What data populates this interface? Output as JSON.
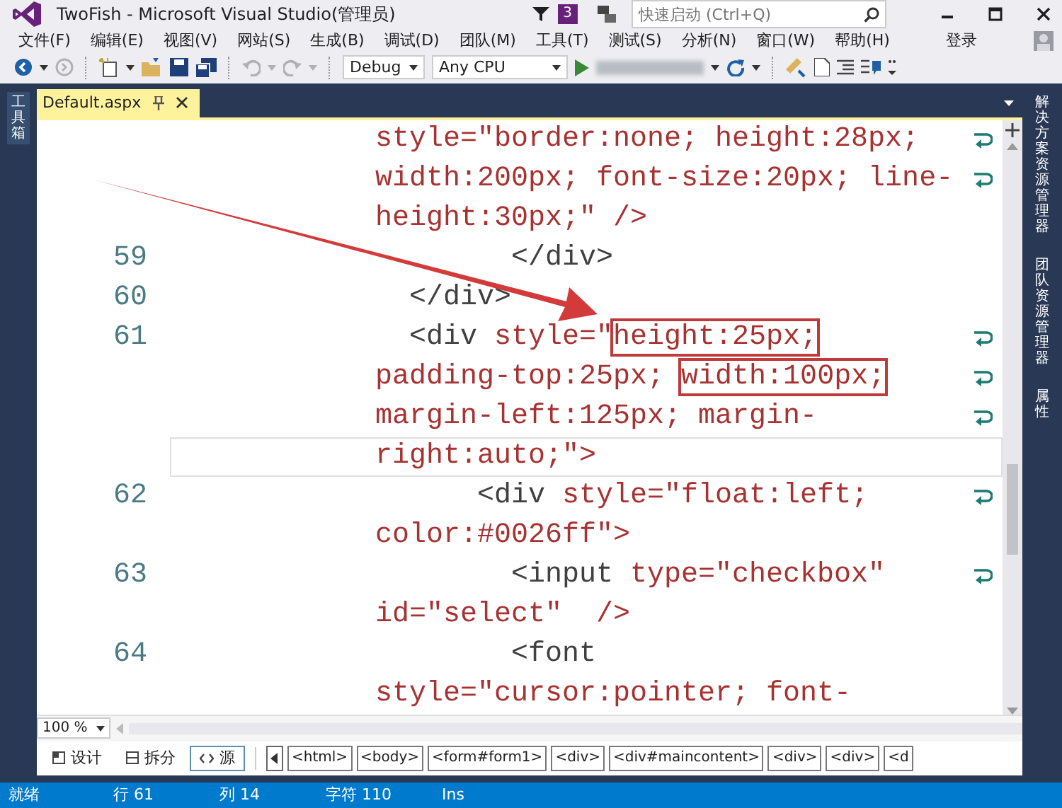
{
  "window": {
    "title": "TwoFish - Microsoft Visual Studio(管理员)",
    "notification_count": "3",
    "quick_launch": {
      "placeholder": "快速启动 (Ctrl+Q)"
    }
  },
  "menu": [
    "文件(F)",
    "编辑(E)",
    "视图(V)",
    "网站(S)",
    "生成(B)",
    "调试(D)",
    "团队(M)",
    "工具(T)",
    "测试(S)",
    "分析(N)",
    "窗口(W)",
    "帮助(H)"
  ],
  "sign_in": "登录",
  "toolbar": {
    "configuration": "Debug",
    "platform": "Any CPU"
  },
  "left_panels": [
    "工具箱"
  ],
  "right_panels": [
    "解决方案资源管理器",
    "团队资源管理器",
    "属性"
  ],
  "document_tab": {
    "title": "Default.aspx"
  },
  "code_lines": [
    {
      "segments": [
        {
          "text": "style=\"border:none; height:28px;",
          "kind": "attr"
        }
      ],
      "wrap": true
    },
    {
      "segments": [
        {
          "text": "width:200px; font-size:20px; line-",
          "kind": "attr"
        }
      ],
      "wrap": true
    },
    {
      "segments": [
        {
          "text": "height:30px;\" />",
          "kind": "attr"
        }
      ],
      "wrap": false
    },
    {
      "number": "59",
      "segments": [
        {
          "text": "        </div>",
          "kind": "tag"
        }
      ],
      "wrap": false
    },
    {
      "number": "60",
      "segments": [
        {
          "text": "  </div>",
          "kind": "tag"
        }
      ],
      "wrap": false
    },
    {
      "number": "61",
      "segments": [
        {
          "text": "  <div ",
          "kind": "tag"
        },
        {
          "text": "style=\"",
          "kind": "attr"
        },
        {
          "text": "height:25px;",
          "kind": "attr",
          "boxed": true
        }
      ],
      "wrap": true
    },
    {
      "segments": [
        {
          "text": "padding-top:25px; ",
          "kind": "attr"
        },
        {
          "text": "width:100px;",
          "kind": "attr",
          "boxed": true
        }
      ],
      "wrap": true
    },
    {
      "segments": [
        {
          "text": "margin-left:125px; margin-",
          "kind": "attr"
        }
      ],
      "wrap": true
    },
    {
      "segments": [
        {
          "text": "right:auto;\">",
          "kind": "attr"
        }
      ],
      "wrap": false,
      "current": true
    },
    {
      "number": "62",
      "segments": [
        {
          "text": "      <div ",
          "kind": "tag"
        },
        {
          "text": "style=\"float:left;",
          "kind": "attr"
        }
      ],
      "wrap": true
    },
    {
      "segments": [
        {
          "text": "color:#0026ff\">",
          "kind": "attr"
        }
      ],
      "wrap": false
    },
    {
      "number": "63",
      "segments": [
        {
          "text": "        <input ",
          "kind": "tag"
        },
        {
          "text": "type=\"checkbox\"",
          "kind": "attr"
        }
      ],
      "wrap": true
    },
    {
      "segments": [
        {
          "text": "id=\"select\"  />",
          "kind": "attr"
        }
      ],
      "wrap": false
    },
    {
      "number": "64",
      "segments": [
        {
          "text": "        <font",
          "kind": "tag"
        }
      ],
      "wrap": false
    },
    {
      "segments": [
        {
          "text": "style=\"cursor:pointer; font-",
          "kind": "attr"
        }
      ],
      "wrap": false
    }
  ],
  "zoom": "100 %",
  "view_tabs": [
    {
      "label": "设计",
      "selected": false
    },
    {
      "label": "拆分",
      "selected": false
    },
    {
      "label": "源",
      "selected": true
    }
  ],
  "breadcrumbs": [
    "<html>",
    "<body>",
    "<form#form1>",
    "<div>",
    "<div#maincontent>",
    "<div>",
    "<div>",
    "<d"
  ],
  "status_bar": {
    "state": "就绪",
    "line": "行 61",
    "column": "列 14",
    "char": "字符 110",
    "mode": "Ins"
  }
}
